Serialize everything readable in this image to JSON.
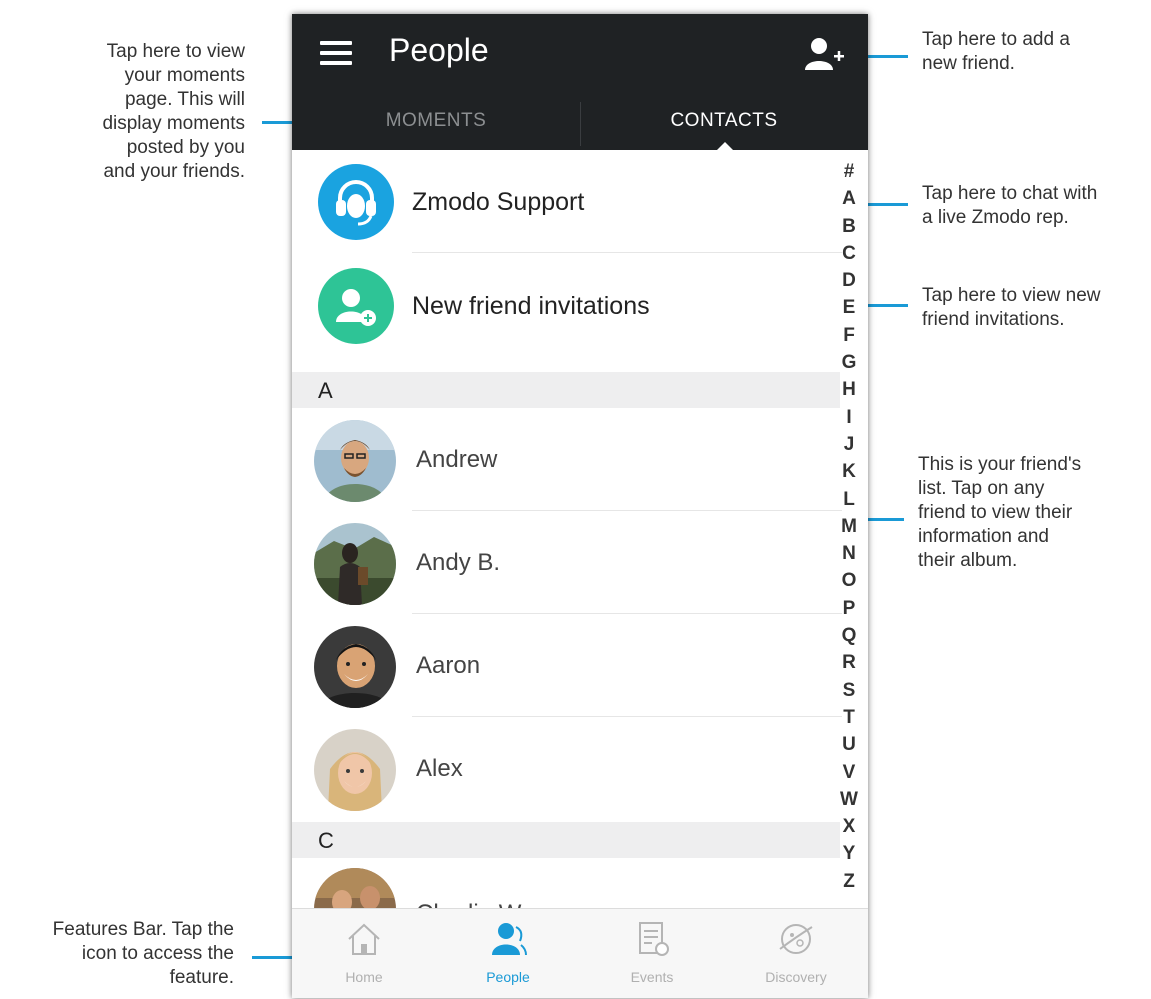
{
  "app": {
    "title": "People",
    "tabs": {
      "moments": "MOMENTS",
      "contacts": "CONTACTS"
    }
  },
  "special_rows": {
    "support": "Zmodo Support",
    "invitations": "New friend invitations"
  },
  "sections": {
    "a": "A",
    "c": "C"
  },
  "contacts": [
    {
      "name": "Andrew"
    },
    {
      "name": "Andy B."
    },
    {
      "name": "Aaron"
    },
    {
      "name": "Alex"
    },
    {
      "name": "Charlie W."
    }
  ],
  "alphabet_index": [
    "#",
    "A",
    "B",
    "C",
    "D",
    "E",
    "F",
    "G",
    "H",
    "I",
    "J",
    "K",
    "L",
    "M",
    "N",
    "O",
    "P",
    "Q",
    "R",
    "S",
    "T",
    "U",
    "V",
    "W",
    "X",
    "Y",
    "Z"
  ],
  "features_bar": {
    "home": "Home",
    "people": "People",
    "events": "Events",
    "discovery": "Discovery"
  },
  "annotations": {
    "moments": [
      "Tap here to view",
      "your moments",
      "page. This will",
      "display moments",
      "posted by you",
      "and your friends."
    ],
    "add_friend": [
      "Tap here to add a",
      "new friend."
    ],
    "support": [
      "Tap here to chat with",
      "a live Zmodo rep."
    ],
    "invitations": [
      "Tap here to view new",
      "friend invitations."
    ],
    "friends_list": [
      "This is your friend's",
      "list. Tap on any",
      "friend to view their",
      "information and",
      "their album."
    ],
    "features": [
      "Features Bar. Tap the",
      "icon to access the",
      "feature."
    ]
  },
  "colors": {
    "appbar": "#1f2224",
    "accent": "#1a9ad6",
    "support_avatar": "#1aa3e0",
    "invite_avatar": "#2ec496"
  }
}
